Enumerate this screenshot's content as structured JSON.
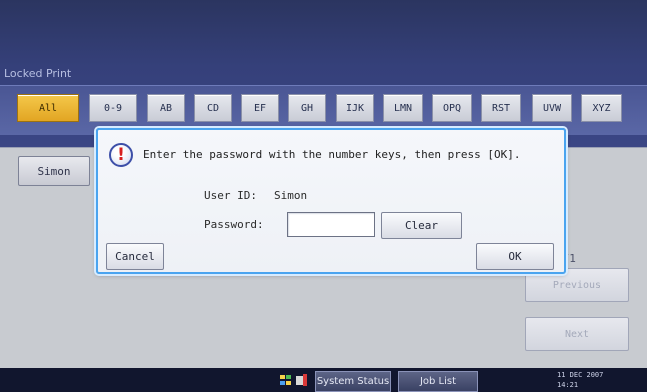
{
  "screen": {
    "title": "Locked Print",
    "tabs": [
      "All",
      "0-9",
      "AB",
      "CD",
      "EF",
      "GH",
      "IJK",
      "LMN",
      "OPQ",
      "RST",
      "UVW",
      "XYZ"
    ],
    "owner": "Simon",
    "pager": {
      "indicator": "1/1",
      "previous": "Previous",
      "next": "Next"
    }
  },
  "dialog": {
    "message": "Enter the password with the number keys, then press [OK].",
    "userid_label": "User ID:",
    "userid_value": "Simon",
    "password_label": "Password:",
    "clear": "Clear",
    "cancel": "Cancel",
    "ok": "OK"
  },
  "footer": {
    "system_status": "System Status",
    "job_list": "Job List",
    "date": "11 DEC  2007",
    "time": "14:21"
  },
  "colors": {
    "selected_tab": "#f4c84a",
    "dialog_border": "#4aa4ef",
    "warning_mark": "#d71f1f"
  }
}
